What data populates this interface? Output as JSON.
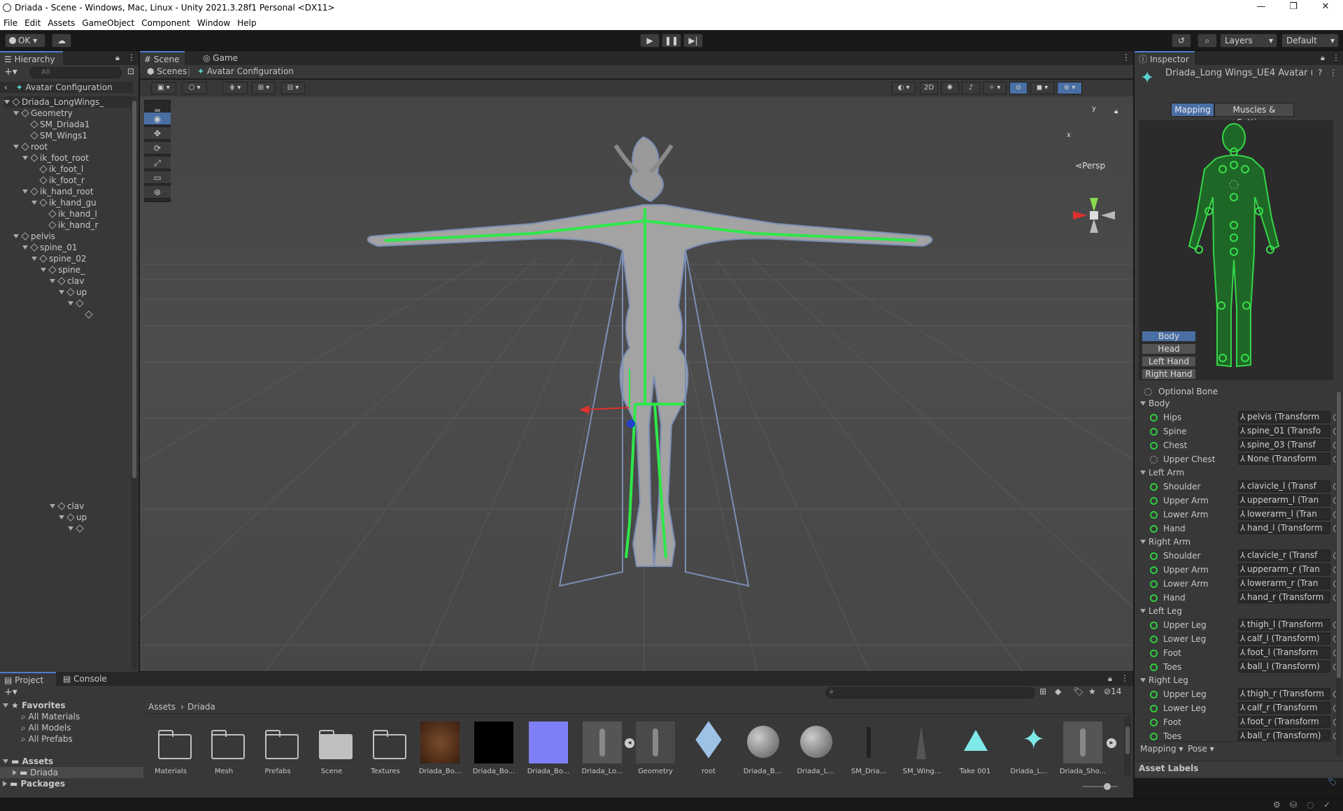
{
  "window": {
    "title": "Driada - Scene - Windows, Mac, Linux - Unity 2021.3.28f1 Personal <DX11>",
    "minimize": "—",
    "maximize": "❐",
    "close": "✕"
  },
  "menu": [
    "File",
    "Edit",
    "Assets",
    "GameObject",
    "Component",
    "Window",
    "Help"
  ],
  "toolbar": {
    "account": "OK",
    "layers": "Layers",
    "layout": "Default"
  },
  "hierarchy": {
    "title": "Hierarchy",
    "search_placeholder": "All",
    "root": "Avatar Configuration",
    "items": [
      {
        "label": "Driada_LongWings_",
        "expanded": true
      },
      {
        "label": "Geometry",
        "expanded": true
      },
      {
        "label": "SM_Driada1"
      },
      {
        "label": "SM_Wings1"
      },
      {
        "label": "root",
        "expanded": true
      },
      {
        "label": "ik_foot_root",
        "expanded": true
      },
      {
        "label": "ik_foot_l"
      },
      {
        "label": "ik_foot_r"
      },
      {
        "label": "ik_hand_root",
        "expanded": true
      },
      {
        "label": "ik_hand_gu",
        "expanded": true
      },
      {
        "label": "ik_hand_l"
      },
      {
        "label": "ik_hand_r"
      },
      {
        "label": "pelvis",
        "expanded": true
      },
      {
        "label": "spine_01",
        "expanded": true
      },
      {
        "label": "spine_02",
        "expanded": true
      },
      {
        "label": "spine_",
        "expanded": true
      },
      {
        "label": "clav",
        "expanded": true
      },
      {
        "label": "up",
        "expanded": true
      },
      {
        "label": ""
      },
      {
        "label": ""
      },
      {
        "label": "clav",
        "expanded": true
      },
      {
        "label": "up",
        "expanded": true
      },
      {
        "label": ""
      }
    ]
  },
  "scene": {
    "tabs": [
      "Scene",
      "Game"
    ],
    "breadcrumb": [
      "Scenes",
      "Avatar Configuration"
    ],
    "mode_2d": "2D",
    "persp": "Persp",
    "gizmo_y": "y",
    "gizmo_x": "x"
  },
  "inspector": {
    "title": "Inspector",
    "object": "Driada_Long Wings_UE4 Avatar (",
    "tabs": [
      "Mapping",
      "Muscles & Settings"
    ],
    "view_buttons": [
      "Body",
      "Head",
      "Left Hand",
      "Right Hand"
    ],
    "optional_bone": "Optional Bone",
    "groups": [
      {
        "name": "Body",
        "bones": [
          {
            "label": "Hips",
            "value": "pelvis (Transform",
            "optional": false
          },
          {
            "label": "Spine",
            "value": "spine_01 (Transfo",
            "optional": false
          },
          {
            "label": "Chest",
            "value": "spine_03 (Transf",
            "optional": false
          },
          {
            "label": "Upper Chest",
            "value": "None (Transform",
            "optional": true
          }
        ]
      },
      {
        "name": "Left Arm",
        "bones": [
          {
            "label": "Shoulder",
            "value": "clavicle_l (Transf",
            "optional": false
          },
          {
            "label": "Upper Arm",
            "value": "upperarm_l (Tran",
            "optional": false
          },
          {
            "label": "Lower Arm",
            "value": "lowerarm_l (Tran",
            "optional": false
          },
          {
            "label": "Hand",
            "value": "hand_l (Transform",
            "optional": false
          }
        ]
      },
      {
        "name": "Right Arm",
        "bones": [
          {
            "label": "Shoulder",
            "value": "clavicle_r (Transf",
            "optional": false
          },
          {
            "label": "Upper Arm",
            "value": "upperarm_r (Tran",
            "optional": false
          },
          {
            "label": "Lower Arm",
            "value": "lowerarm_r (Tran",
            "optional": false
          },
          {
            "label": "Hand",
            "value": "hand_r (Transform",
            "optional": false
          }
        ]
      },
      {
        "name": "Left Leg",
        "bones": [
          {
            "label": "Upper Leg",
            "value": "thigh_l (Transform",
            "optional": false
          },
          {
            "label": "Lower Leg",
            "value": "calf_l (Transform)",
            "optional": false
          },
          {
            "label": "Foot",
            "value": "foot_l (Transform",
            "optional": false
          },
          {
            "label": "Toes",
            "value": "ball_l (Transform)",
            "optional": false
          }
        ]
      },
      {
        "name": "Right Leg",
        "bones": [
          {
            "label": "Upper Leg",
            "value": "thigh_r (Transform",
            "optional": false
          },
          {
            "label": "Lower Leg",
            "value": "calf_r (Transform",
            "optional": false
          },
          {
            "label": "Foot",
            "value": "foot_r (Transform",
            "optional": false
          },
          {
            "label": "Toes",
            "value": "ball_r (Transform)",
            "optional": false
          }
        ]
      }
    ],
    "mapping_dropdown": "Mapping",
    "pose_dropdown": "Pose",
    "asset_labels": "Asset Labels"
  },
  "project": {
    "tabs": [
      "Project",
      "Console"
    ],
    "favorites": "Favorites",
    "favorite_items": [
      "All Materials",
      "All Models",
      "All Prefabs"
    ],
    "assets": "Assets",
    "asset_children": [
      "Driada"
    ],
    "packages": "Packages",
    "breadcrumb": [
      "Assets",
      "Driada"
    ],
    "hidden_count": "14",
    "items": [
      {
        "name": "Materials",
        "kind": "folder"
      },
      {
        "name": "Mesh",
        "kind": "folder"
      },
      {
        "name": "Prefabs",
        "kind": "folder"
      },
      {
        "name": "Scene",
        "kind": "folder-filled"
      },
      {
        "name": "Textures",
        "kind": "folder"
      },
      {
        "name": "Driada_Bo...",
        "kind": "tex-brown"
      },
      {
        "name": "Driada_Bo...",
        "kind": "tex-black"
      },
      {
        "name": "Driada_Bo...",
        "kind": "tex-normal"
      },
      {
        "name": "Driada_Lo...",
        "kind": "model"
      },
      {
        "name": "Geometry",
        "kind": "model-child"
      },
      {
        "name": "root",
        "kind": "cube"
      },
      {
        "name": "Driada_B...",
        "kind": "sphere"
      },
      {
        "name": "Driada_L...",
        "kind": "sphere"
      },
      {
        "name": "SM_Dria...",
        "kind": "mesh"
      },
      {
        "name": "SM_Wing...",
        "kind": "mesh2"
      },
      {
        "name": "Take 001",
        "kind": "anim"
      },
      {
        "name": "Driada_L...",
        "kind": "avatar"
      },
      {
        "name": "Driada_Sho...",
        "kind": "model"
      }
    ]
  }
}
